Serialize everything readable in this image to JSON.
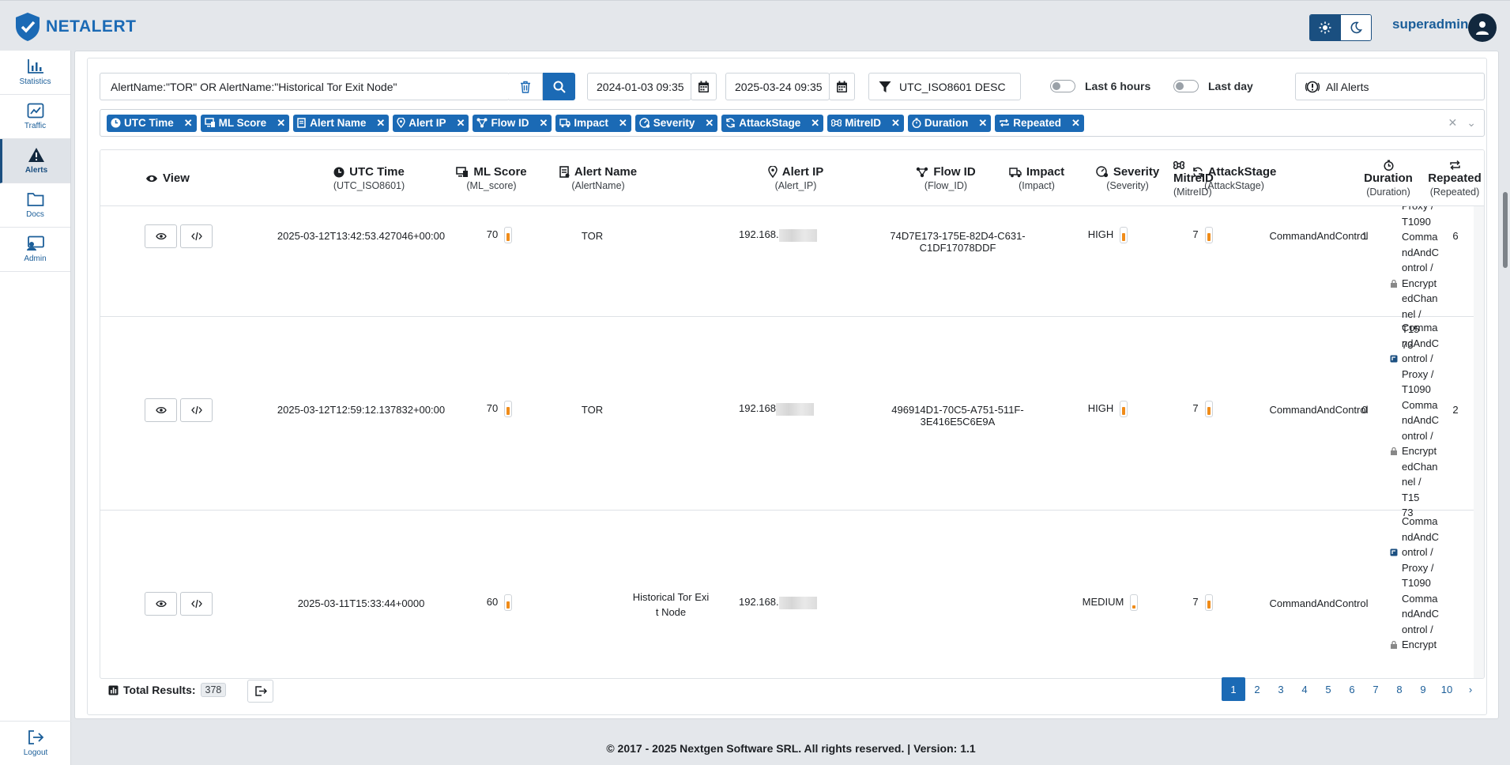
{
  "app": {
    "brand": "NETALERT",
    "user": "superadmin"
  },
  "sidebar": {
    "items": [
      {
        "label": "Statistics",
        "icon": "bar-chart-icon"
      },
      {
        "label": "Traffic",
        "icon": "line-chart-icon"
      },
      {
        "label": "Alerts",
        "icon": "warning-icon",
        "active": true
      },
      {
        "label": "Docs",
        "icon": "folder-icon"
      },
      {
        "label": "Admin",
        "icon": "admin-icon"
      }
    ],
    "logout": "Logout"
  },
  "filters": {
    "query": "AlertName:\"TOR\" OR AlertName:\"Historical Tor Exit Node\"",
    "date_from": "2024-01-03 09:35",
    "date_to": "2025-03-24 09:35",
    "sort": "UTC_ISO8601 DESC",
    "last6h": "Last 6 hours",
    "lastday": "Last day",
    "alert_filter": "All Alerts"
  },
  "chips": [
    "UTC Time",
    "ML Score",
    "Alert Name",
    "Alert IP",
    "Flow ID",
    "Impact",
    "Severity",
    "AttackStage",
    "MitreID",
    "Duration",
    "Repeated"
  ],
  "columns": {
    "view": "View",
    "utc": {
      "title": "UTC Time",
      "sub": "(UTC_ISO8601)"
    },
    "ml": {
      "title": "ML Score",
      "sub": "(ML_score)"
    },
    "name": {
      "title": "Alert Name",
      "sub": "(AlertName)"
    },
    "ip": {
      "title": "Alert IP",
      "sub": "(Alert_IP)"
    },
    "flow": {
      "title": "Flow ID",
      "sub": "(Flow_ID)"
    },
    "impact": {
      "title": "Impact",
      "sub": "(Impact)"
    },
    "severity": {
      "title": "Severity",
      "sub": "(Severity)"
    },
    "stage": {
      "title": "AttackStage",
      "sub": "(AttackStage)"
    },
    "mitre": {
      "title": "MitreID",
      "sub": "(MitreID)"
    },
    "duration": {
      "title": "Duration",
      "sub": "(Duration)"
    },
    "repeated": {
      "title": "Repeated",
      "sub": "(Repeated)"
    }
  },
  "rows": [
    {
      "time": "2025-03-12T13:42:53.427046+00:00",
      "ml": "70",
      "ml_level": 0.6,
      "name": "TOR",
      "ip": "192.168.",
      "flow": "74D7E173-175E-82D4-C631-C1DF17078DDF",
      "impact": "HIGH",
      "impact_level": 0.6,
      "severity": "7",
      "severity_level": 0.6,
      "stage": "CommandAndControl",
      "mitre": [
        "Proxy /",
        "T1090",
        "Comma",
        "ndAndC",
        "ontrol /",
        "Encrypt",
        "edChan",
        "nel / T15",
        "73"
      ],
      "duration": "1",
      "repeated": "6"
    },
    {
      "time": "2025-03-12T12:59:12.137832+00:00",
      "ml": "70",
      "ml_level": 0.6,
      "name": "TOR",
      "ip": "192.168",
      "flow": "496914D1-70C5-A751-511F-3E416E5C6E9A",
      "impact": "HIGH",
      "impact_level": 0.6,
      "severity": "7",
      "severity_level": 0.6,
      "stage": "CommandAndControl",
      "mitre": [
        "Comma",
        "ndAndC",
        "ontrol /",
        "Proxy /",
        "T1090",
        "Comma",
        "ndAndC",
        "ontrol /",
        "Encrypt",
        "edChan",
        "nel / T15",
        "73"
      ],
      "duration": "0",
      "repeated": "2"
    },
    {
      "time": "2025-03-11T15:33:44+0000",
      "ml": "60",
      "ml_level": 0.55,
      "name": "Historical Tor Exit Node",
      "ip": "192.168.",
      "flow": "",
      "impact": "MEDIUM",
      "impact_level": 0.25,
      "severity": "7",
      "severity_level": 0.6,
      "stage": "CommandAndControl",
      "mitre": [
        "Comma",
        "ndAndC",
        "ontrol /",
        "Proxy /",
        "T1090",
        "Comma",
        "ndAndC",
        "ontrol /",
        "Encrypt"
      ],
      "duration": "",
      "repeated": ""
    }
  ],
  "footer": {
    "total_label": "Total Results:",
    "total": "378",
    "pages": [
      "1",
      "2",
      "3",
      "4",
      "5",
      "6",
      "7",
      "8",
      "9",
      "10",
      "›"
    ],
    "current_page": "1",
    "copyright": "© 2017 - 2025 Nextgen Software SRL. All rights reserved. | Version: 1.1"
  },
  "colors": {
    "accent": "#1b6ab5",
    "bar": "#f08c1a",
    "dark": "#12283e"
  }
}
